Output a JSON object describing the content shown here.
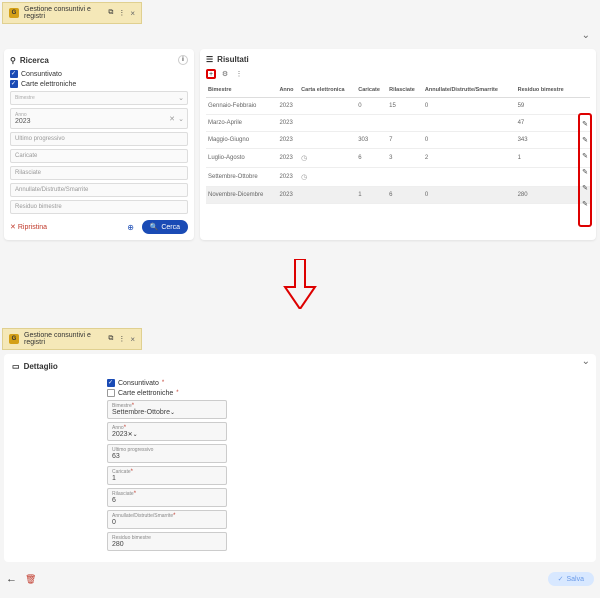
{
  "top": {
    "tab_title": "Gestione consuntivi e registri",
    "collapse": "⌄"
  },
  "search": {
    "title": "Ricerca",
    "chk_consuntivato": "Consuntivato",
    "chk_carte": "Carte elettroniche",
    "bimestre": {
      "label": "Bimestre",
      "value": ""
    },
    "anno": {
      "label": "Anno",
      "value": "2023"
    },
    "ultimo": "Ultimo progressivo",
    "caricate": "Caricate",
    "rilasciate": "Rilasciate",
    "ads": "Annullate/Distrutte/Smarrite",
    "residuo": "Residuo bimestre",
    "reset": "Ripristina",
    "cerca": "Cerca"
  },
  "results": {
    "title": "Risultati",
    "cols": [
      "Bimestre",
      "Anno",
      "Carta elettronica",
      "Caricate",
      "Rilasciate",
      "Annullate/Distrutte/Smarrite",
      "Residuo bimestre",
      ""
    ],
    "rows": [
      [
        "Gennaio-Febbraio",
        "2023",
        "",
        "0",
        "15",
        "0",
        "59"
      ],
      [
        "Marzo-Aprile",
        "2023",
        "",
        "",
        "",
        "",
        "47"
      ],
      [
        "Maggio-Giugno",
        "2023",
        "",
        "303",
        "7",
        "0",
        "343"
      ],
      [
        "Luglio-Agosto",
        "2023",
        "clock",
        "6",
        "3",
        "2",
        "1"
      ],
      [
        "Settembre-Ottobre",
        "2023",
        "clock",
        "",
        "",
        "",
        ""
      ],
      [
        "Novembre-Dicembre",
        "2023",
        "",
        "1",
        "6",
        "0",
        "280"
      ]
    ]
  },
  "detail": {
    "tab_title": "Gestione consuntivi e registri",
    "title": "Dettaglio",
    "chk_consuntivato": "Consuntivato",
    "chk_carte": "Carte elettroniche",
    "bimestre": {
      "label": "Bimestre",
      "value": "Settembre-Ottobre"
    },
    "anno": {
      "label": "Anno",
      "value": "2023"
    },
    "ultimo": {
      "label": "Ultimo progressivo",
      "value": "63"
    },
    "caricate": {
      "label": "Caricate",
      "value": "1"
    },
    "rilasciate": {
      "label": "Rilasciate",
      "value": "6"
    },
    "ads": {
      "label": "Annullate/Distrutte/Smarrite",
      "value": "0"
    },
    "residuo": {
      "label": "Residuo bimestre",
      "value": "280"
    },
    "salva": "Salva"
  }
}
